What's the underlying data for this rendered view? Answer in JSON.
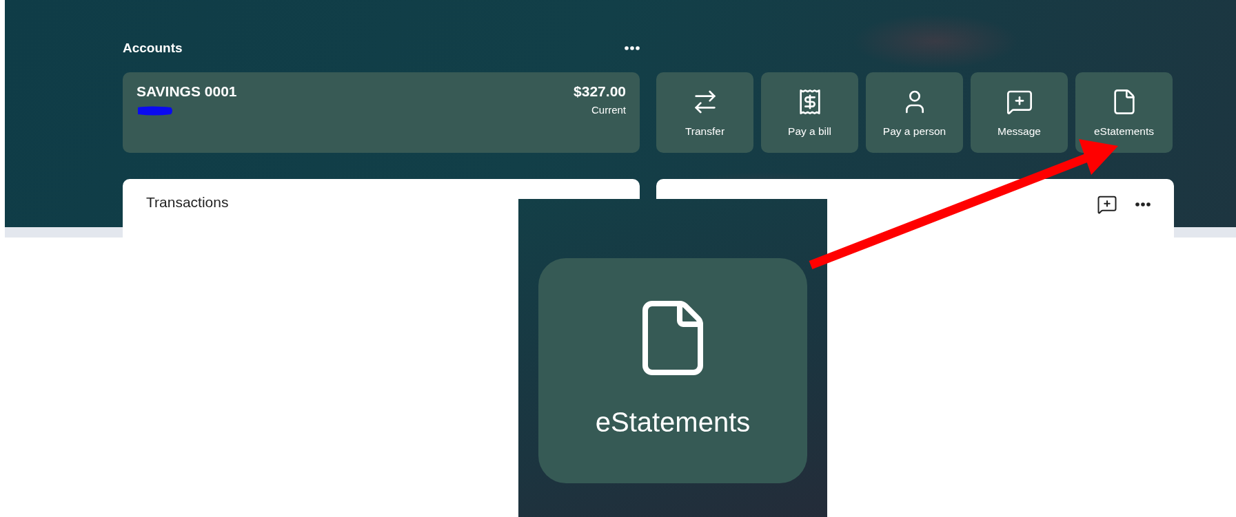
{
  "accounts": {
    "title": "Accounts",
    "account": {
      "name": "SAVINGS 0001",
      "balance": "$327.00",
      "status": "Current"
    }
  },
  "actions": [
    {
      "label": "Transfer",
      "kind": "transfer"
    },
    {
      "label": "Pay a bill",
      "kind": "bill"
    },
    {
      "label": "Pay a person",
      "kind": "person"
    },
    {
      "label": "Message",
      "kind": "message"
    },
    {
      "label": "eStatements",
      "kind": "document"
    }
  ],
  "transactions_card": {
    "title": "Transactions"
  },
  "callout": {
    "label": "eStatements",
    "kind": "document"
  }
}
